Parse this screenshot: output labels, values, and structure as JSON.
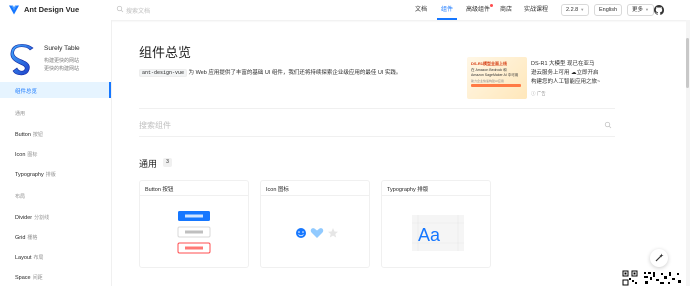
{
  "header": {
    "brand": "Ant Design Vue",
    "search_placeholder": "搜索文档",
    "nav": [
      {
        "label": "文档",
        "active": false
      },
      {
        "label": "组件",
        "active": true
      },
      {
        "label": "高级组件",
        "active": false,
        "badge": true
      },
      {
        "label": "商店",
        "active": false
      },
      {
        "label": "实战课程",
        "active": false
      }
    ],
    "version": "2.2.8",
    "language": "English",
    "more": "更多",
    "github_icon": "github-icon",
    "accent_color": "#1677ff"
  },
  "sidebar": {
    "ad": {
      "title": "Surely Table",
      "line1": "构建更快的网站",
      "line2": "更快的构建网站"
    },
    "selected_item": "组件总览",
    "groups": [
      {
        "title": "通用",
        "items": [
          {
            "en": "Button",
            "zh": "按钮"
          },
          {
            "en": "Icon",
            "zh": "图标"
          },
          {
            "en": "Typography",
            "zh": "排版"
          }
        ]
      },
      {
        "title": "布局",
        "items": [
          {
            "en": "Divider",
            "zh": "分割线"
          },
          {
            "en": "Grid",
            "zh": "栅格"
          },
          {
            "en": "Layout",
            "zh": "布局"
          },
          {
            "en": "Space",
            "zh": "间距"
          }
        ]
      }
    ]
  },
  "main": {
    "title": "组件总览",
    "intro": {
      "code": "ant-design-vue",
      "text": "为 Web 应用提供了丰富的基础 UI 组件，我们还将持续探索企业级应用的最佳 UI 实践。"
    },
    "promo": {
      "img_line1": "DS-R1模型全面上线",
      "img_line2": "在 Amazon Bedrock 和",
      "img_line3": "Amazon SageMaker AI 中可用",
      "img_line4": "助力企业快速构建AI应用",
      "line1": "DS-R1 大模型 现已在亚马",
      "line2": "逊云服务上可用 ☁立即开启",
      "line3": "构建您的人工智能应用之旅~",
      "ad_label": "广告"
    },
    "search_placeholder": "搜索组件",
    "section": {
      "title": "通用",
      "count": "3"
    },
    "cards": [
      {
        "label": "Button 按钮"
      },
      {
        "label": "Icon 图标"
      },
      {
        "label": "Typography 排版"
      }
    ],
    "typography_glyph": "Aa"
  }
}
